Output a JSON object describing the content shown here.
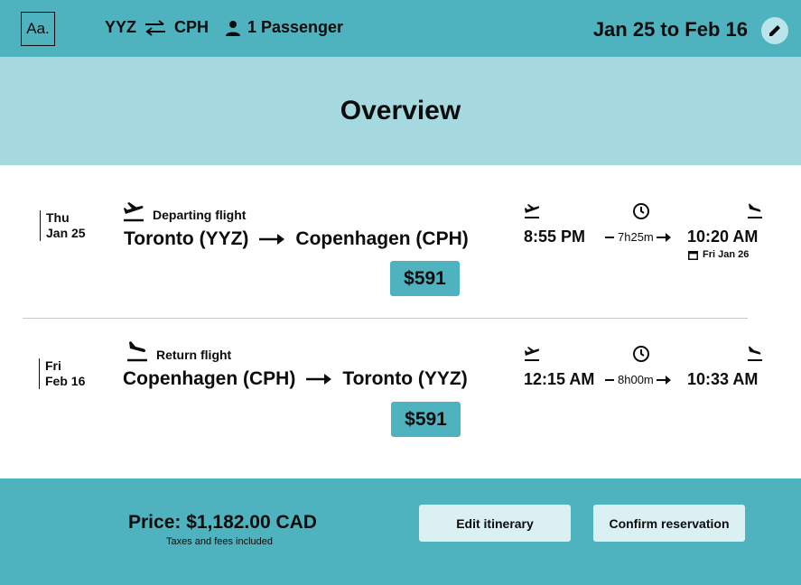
{
  "header": {
    "logo_text": "Aa.",
    "origin": "YYZ",
    "destination": "CPH",
    "passengers": "1 Passenger",
    "date_range": "Jan 25 to Feb 16"
  },
  "overview": {
    "title": "Overview"
  },
  "flights": [
    {
      "day": "Thu",
      "date": "Jan 25",
      "type": "Departing flight",
      "from": "Toronto (YYZ)",
      "to": "Copenhagen (CPH)",
      "price": "$591",
      "depart_time": "8:55 PM",
      "duration": "7h25m",
      "arrive_time": "10:20 AM",
      "arrive_note": "Fri Jan 26"
    },
    {
      "day": "Fri",
      "date": "Feb 16",
      "type": "Return flight",
      "from": "Copenhagen (CPH)",
      "to": "Toronto (YYZ)",
      "price": "$591",
      "depart_time": "12:15 AM",
      "duration": "8h00m",
      "arrive_time": "10:33 AM"
    }
  ],
  "footer": {
    "total": "Price: $1,182.00 CAD",
    "taxes_note": "Taxes and fees included",
    "edit_label": "Edit itinerary",
    "confirm_label": "Confirm reservation"
  },
  "colors": {
    "header_teal": "#4fb3bf",
    "overview_band": "#a5d9df",
    "button_light": "#daf0f3",
    "text": "#0c0c0c"
  },
  "icons": [
    "swap-arrows-icon",
    "person-icon",
    "pencil-icon",
    "takeoff-icon",
    "landing-icon",
    "clock-icon",
    "calendar-icon",
    "right-arrow-icon"
  ]
}
